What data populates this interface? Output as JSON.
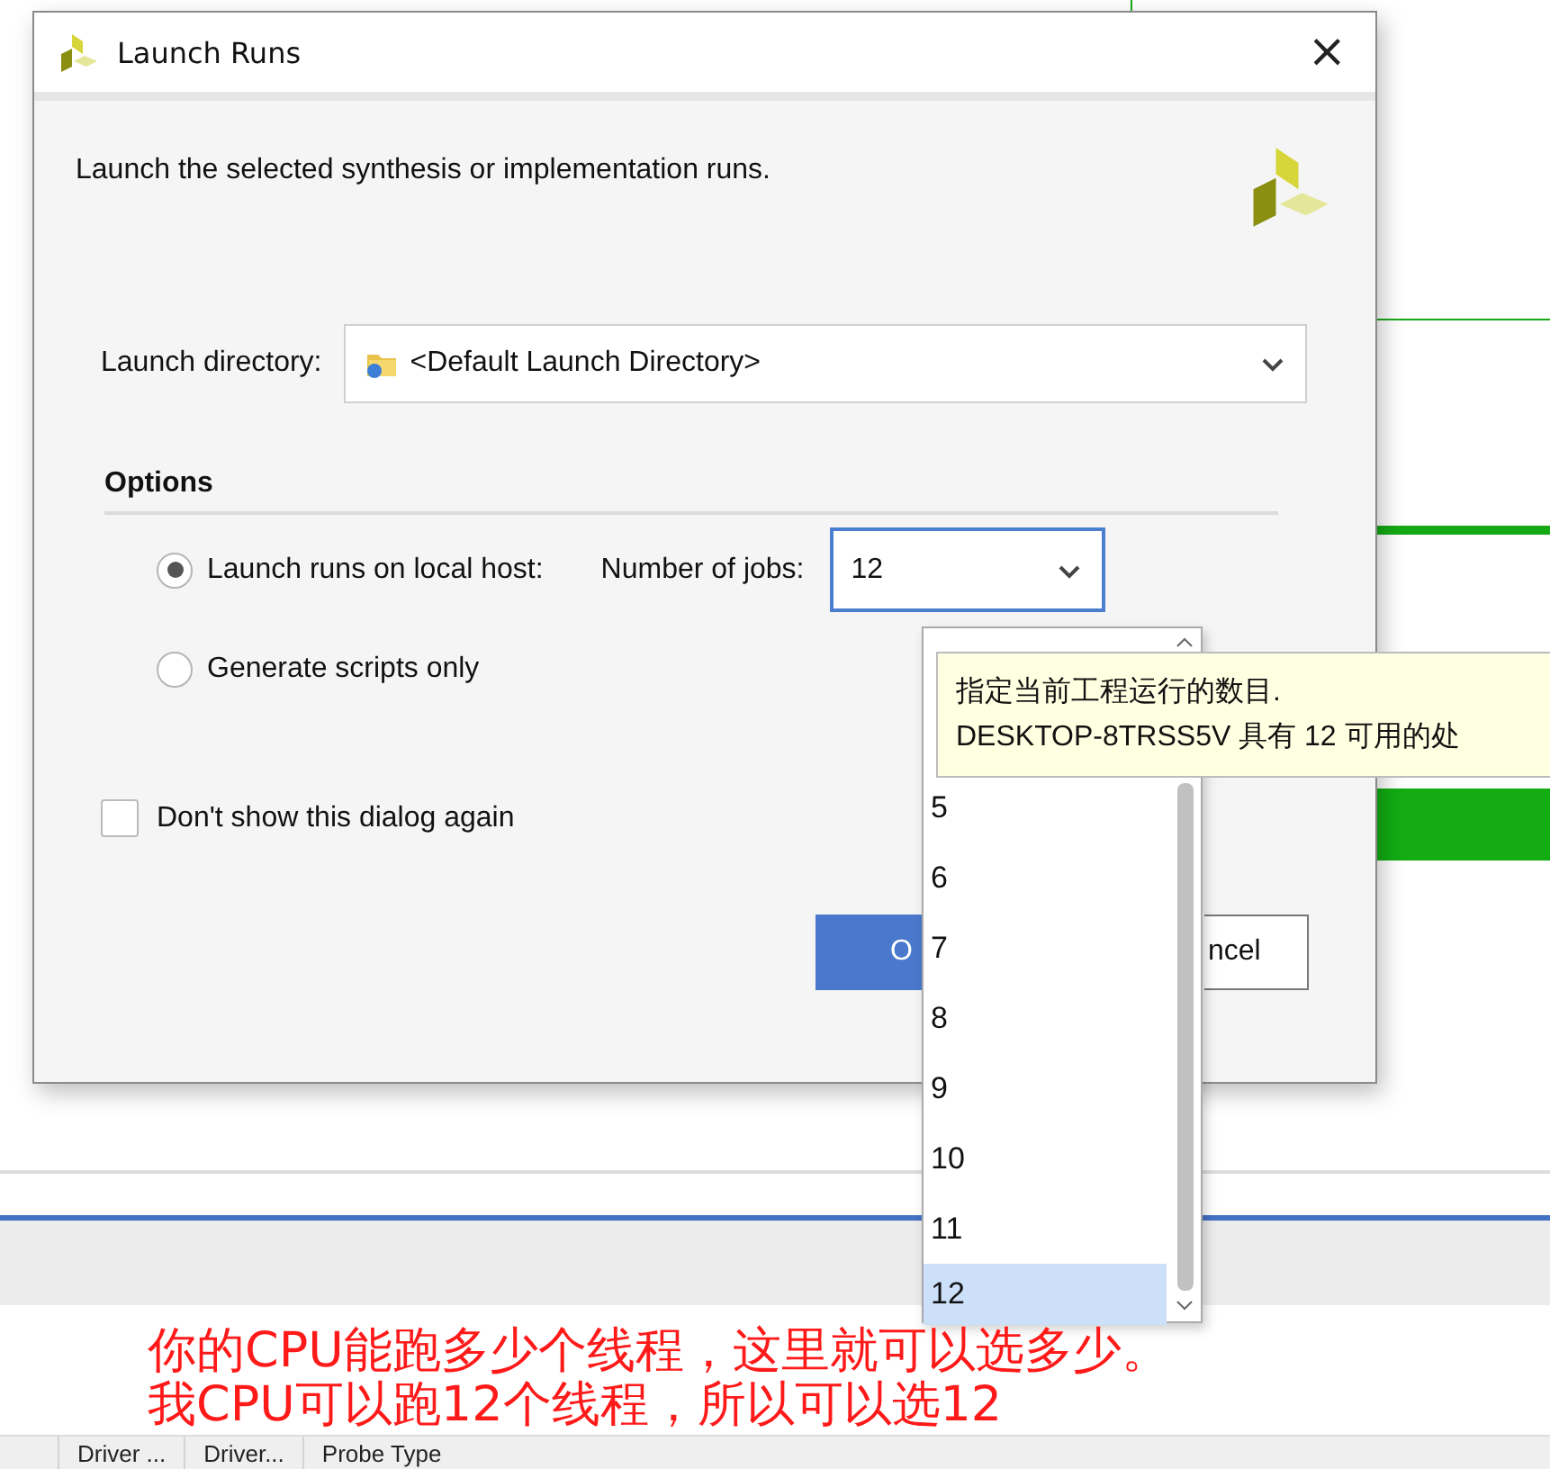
{
  "dialog": {
    "title": "Launch Runs",
    "close": "×",
    "description": "Launch the selected synthesis or implementation runs.",
    "directory_label": "Launch directory:",
    "directory_value": "<Default Launch Directory>",
    "options_heading": "Options",
    "modes": [
      {
        "label": "Launch runs on local host:",
        "selected": true
      },
      {
        "label": "Generate scripts only",
        "selected": false
      }
    ],
    "jobs_label": "Number of jobs:",
    "jobs_value": "12",
    "dont_show": {
      "label": "Don't show this dialog again",
      "checked": false
    },
    "buttons": [
      {
        "label": "O",
        "kind": "primary"
      },
      {
        "label": "ncel",
        "kind": "secondary"
      }
    ]
  },
  "jobs_list": [
    {
      "label": "5",
      "selected": false
    },
    {
      "label": "6",
      "selected": false
    },
    {
      "label": "7",
      "selected": false
    },
    {
      "label": "8",
      "selected": false
    },
    {
      "label": "9",
      "selected": false
    },
    {
      "label": "10",
      "selected": false
    },
    {
      "label": "11",
      "selected": false
    },
    {
      "label": "12",
      "selected": true
    }
  ],
  "tooltip": {
    "lines": [
      "指定当前工程运行的数目.",
      "DESKTOP-8TRSS5V 具有 12 可用的处"
    ]
  },
  "table": {
    "columns": [
      "Driver ...",
      "Driver...",
      "Probe Type"
    ]
  },
  "annotation": {
    "lines": [
      "你的CPU能跑多少个线程，这里就可以选多少。",
      "我CPU可以跑12个线程，所以可以选12"
    ]
  }
}
